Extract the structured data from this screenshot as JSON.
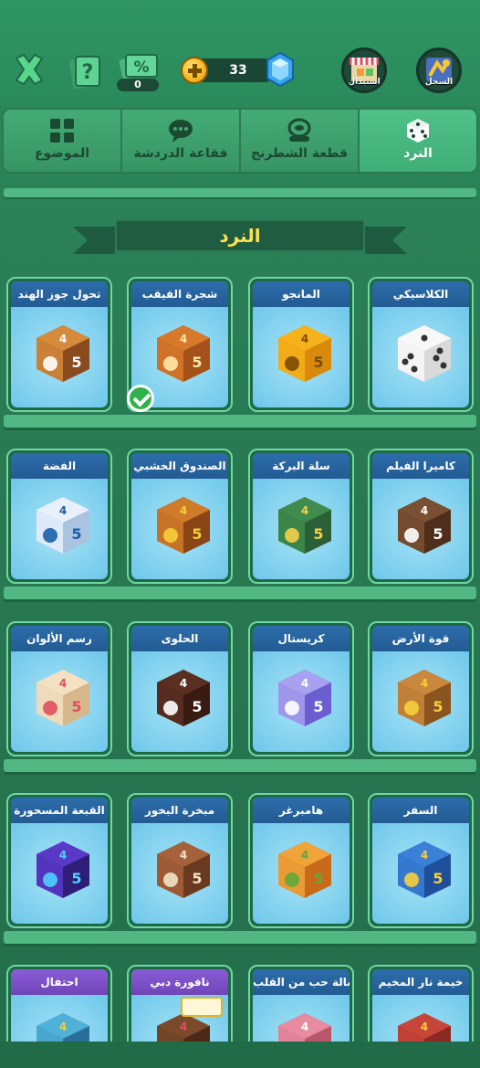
{
  "topbar": {
    "pct_count": "0",
    "gems_count": "33",
    "shop_label": "استبدال",
    "log_label": "السجل"
  },
  "tabs": [
    {
      "label": "الموضوع",
      "icon": "grid-icon"
    },
    {
      "label": "فقاعة الدردشة",
      "icon": "chat-bubble-icon"
    },
    {
      "label": "قطعة الشطرنج",
      "icon": "chess-piece-icon"
    },
    {
      "label": "النرد",
      "icon": "dice-icon",
      "active": true
    }
  ],
  "section_title": "النرد",
  "rows": [
    [
      {
        "name": "الكلاسيكي",
        "dice": "classic-white-dice"
      },
      {
        "name": "المانجو",
        "dice": "mango-dice"
      },
      {
        "name": "شجرة القيقب",
        "dice": "maple-dice",
        "selected": true
      },
      {
        "name": "تحول جوز الهند",
        "dice": "coconut-dice"
      }
    ],
    [
      {
        "name": "كاميرا الفيلم",
        "dice": "film-camera-dice"
      },
      {
        "name": "سلة البركة",
        "dice": "blessing-basket-dice"
      },
      {
        "name": "الصندوق الخشبي",
        "dice": "wooden-crate-dice"
      },
      {
        "name": "الفضة",
        "dice": "silver-dice"
      }
    ],
    [
      {
        "name": "قوة الأرض",
        "dice": "earth-power-dice"
      },
      {
        "name": "كريستال",
        "dice": "crystal-dice"
      },
      {
        "name": "الحلوى",
        "dice": "candy-dice"
      },
      {
        "name": "رسم الألوان",
        "dice": "color-painting-dice"
      }
    ],
    [
      {
        "name": "السفر",
        "dice": "travel-dice"
      },
      {
        "name": "هامبرغر",
        "dice": "hamburger-dice"
      },
      {
        "name": "مبخرة البخور",
        "dice": "incense-burner-dice"
      },
      {
        "name": "القبعة المسحورة",
        "dice": "magic-hat-dice"
      }
    ],
    [
      {
        "name": "خيمة نار المخيم",
        "dice": "campfire-tent-dice"
      },
      {
        "name": "رسالة حب من القلب",
        "dice": "love-letter-dice"
      },
      {
        "name": "نافورة دبي",
        "dice": "dubai-fountain-dice",
        "purple": true,
        "badge": true
      },
      {
        "name": "احتفال",
        "dice": "celebration-dice",
        "purple": true
      }
    ]
  ]
}
